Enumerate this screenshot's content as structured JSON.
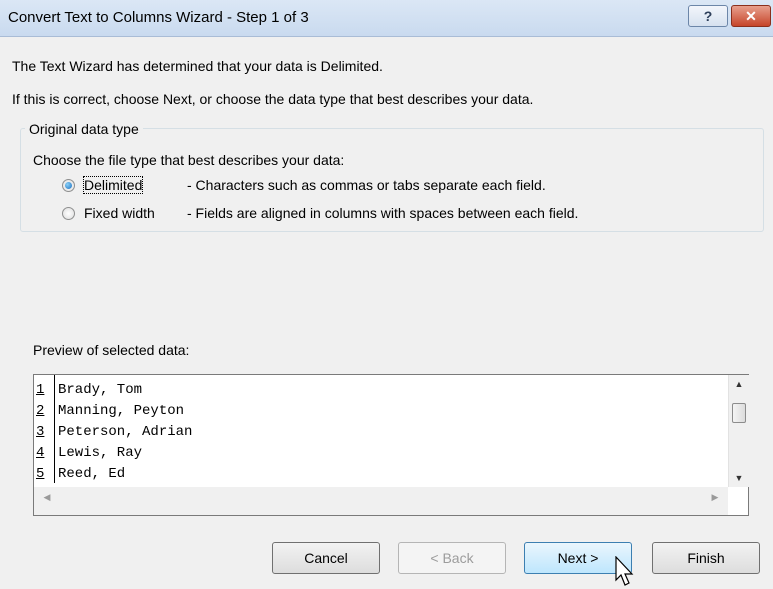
{
  "window": {
    "title": "Convert Text to Columns Wizard - Step 1 of 3",
    "help_glyph": "?",
    "close_glyph": "✕"
  },
  "intro": {
    "line1": "The Text Wizard has determined that your data is Delimited.",
    "line2": "If this is correct, choose Next, or choose the data type that best describes your data."
  },
  "original_data_type": {
    "legend": "Original data type",
    "prompt": "Choose the file type that best describes your data:",
    "options": [
      {
        "label": "Delimited",
        "description": "- Characters such as commas or tabs separate each field.",
        "selected": true
      },
      {
        "label": "Fixed width",
        "description": "- Fields are aligned in columns with spaces between each field.",
        "selected": false
      }
    ]
  },
  "preview": {
    "label": "Preview of selected data:",
    "rows": [
      {
        "num": "1",
        "text": "Brady, Tom"
      },
      {
        "num": "2",
        "text": "Manning, Peyton"
      },
      {
        "num": "3",
        "text": "Peterson, Adrian"
      },
      {
        "num": "4",
        "text": "Lewis, Ray"
      },
      {
        "num": "5",
        "text": "Reed, Ed"
      }
    ]
  },
  "buttons": {
    "cancel": "Cancel",
    "back": "< Back",
    "next": "Next >",
    "finish": "Finish"
  }
}
